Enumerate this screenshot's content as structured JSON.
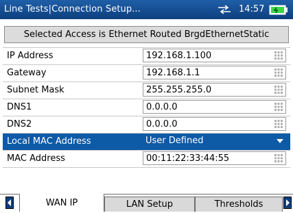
{
  "titlebar": {
    "title": "Line Tests|Connection Setup...",
    "time": "14:57",
    "network_icon": "network-arrows-icon",
    "battery_icon": "battery-icon"
  },
  "banner": "Selected Access  is Ethernet Routed BrgdEthernetStatic",
  "fields": [
    {
      "label": "IP Address",
      "value": "192.168.1.100"
    },
    {
      "label": "Gateway",
      "value": "192.168.1.1"
    },
    {
      "label": "Subnet Mask",
      "value": "255.255.255.0"
    },
    {
      "label": "DNS1",
      "value": "0.0.0.0"
    },
    {
      "label": "DNS2",
      "value": "0.0.0.0"
    },
    {
      "label": "Local MAC Address",
      "value": "User Defined"
    },
    {
      "label": "MAC Address",
      "value": "00:11:22:33:44:55"
    }
  ],
  "tabs": [
    {
      "label": "WAN IP"
    },
    {
      "label": "LAN Setup"
    },
    {
      "label": "Thresholds"
    }
  ],
  "colors": {
    "titlebar": "#0d3f7e",
    "selected_row": "#0d5aa7",
    "banner_bg": "#dcdcdc",
    "battery": "#39d64a"
  }
}
